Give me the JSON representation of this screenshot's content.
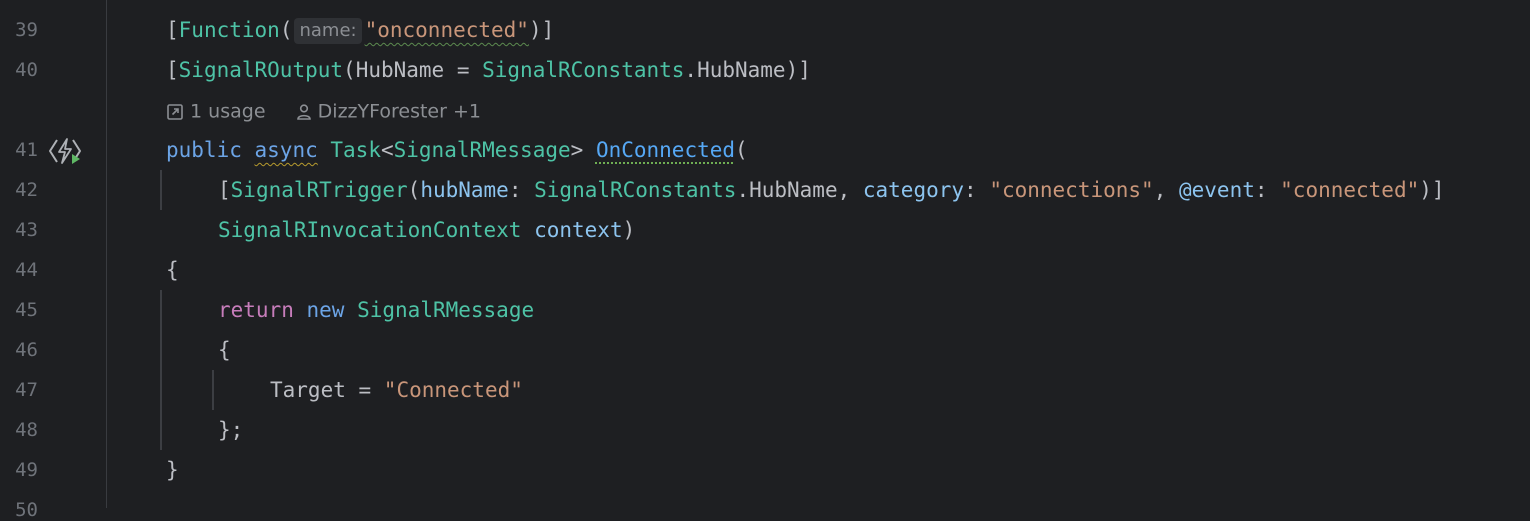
{
  "gutter": {
    "line_numbers": [
      "39",
      "40",
      "41",
      "42",
      "43",
      "44",
      "45",
      "46",
      "47",
      "48",
      "49",
      "50"
    ]
  },
  "code_vision": {
    "usages": "1 usage",
    "author": "DizzYForester +1",
    "icons": [
      "external-link-icon",
      "person-icon"
    ]
  },
  "gutter_icon": "azure-function-run-icon",
  "code": {
    "l39": {
      "open": "[",
      "type": "Function",
      "paren": "(",
      "hint": "name:",
      "str": "\"onconnected\"",
      "close": ")]"
    },
    "l40": {
      "open": "[",
      "type": "SignalROutput",
      "paren": "(",
      "text1": "HubName = ",
      "type2": "SignalRConstants",
      "text2": ".HubName)]"
    },
    "l41": {
      "kw1": "public",
      "kw2": "async",
      "type1": "Task",
      "lt": "<",
      "type2": "SignalRMessage",
      "gt": "> ",
      "method": "OnConnected",
      "paren": "("
    },
    "l42": {
      "open": "[",
      "type1": "SignalRTrigger",
      "paren": "(",
      "p1": "hubName",
      "c1": ": ",
      "type2": "SignalRConstants",
      "t1": ".HubName, ",
      "p2": "category",
      "c2": ": ",
      "s1": "\"connections\"",
      "t2": ", ",
      "p3": "@event",
      "c3": ": ",
      "s2": "\"connected\"",
      "close": ")]"
    },
    "l43": {
      "type": "SignalRInvocationContext",
      "space": " ",
      "param": "context",
      "close": ")"
    },
    "l44": {
      "text": "{"
    },
    "l45": {
      "kw1": "return",
      "kw2": "new",
      "type": "SignalRMessage"
    },
    "l46": {
      "text": "{"
    },
    "l47": {
      "prop": "Target = ",
      "str": "\"Connected\""
    },
    "l48": {
      "text": "};"
    },
    "l49": {
      "text": "}"
    }
  },
  "colors": {
    "background": "#1e1f22",
    "keyword": "#6ca4e6",
    "return_keyword": "#c77dbb",
    "type": "#4ec3a6",
    "string": "#c9967a",
    "parameter": "#8dc4ef",
    "text": "#bcbec4",
    "line_number": "#6f737a"
  }
}
